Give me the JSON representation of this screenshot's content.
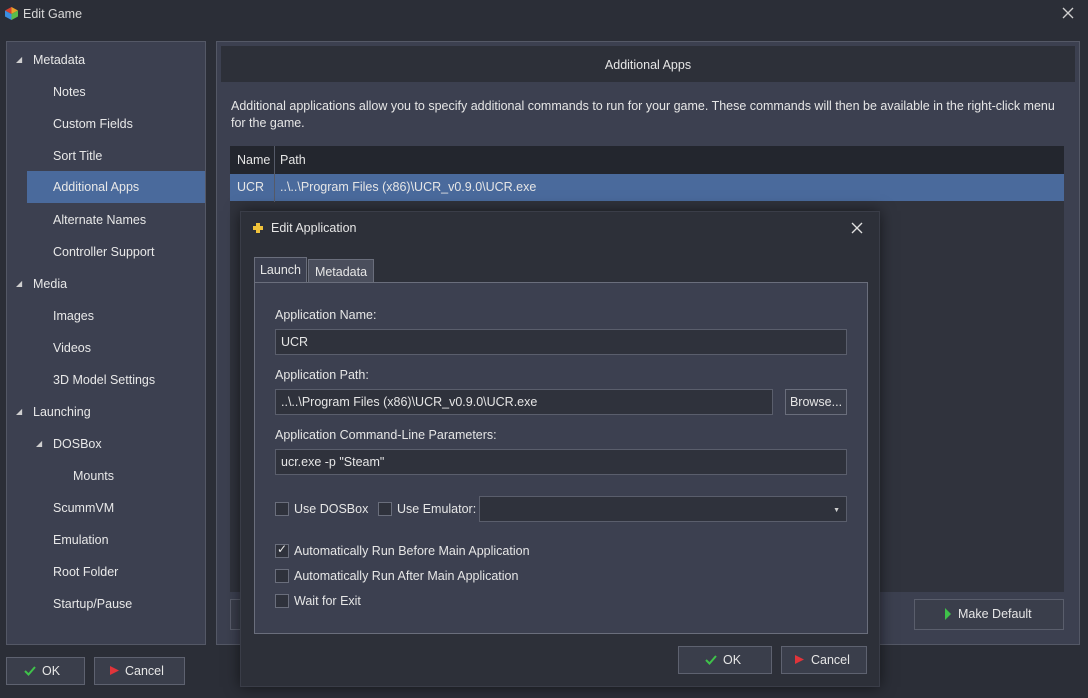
{
  "window": {
    "title": "Edit Game"
  },
  "sidebar": {
    "items": [
      {
        "label": "Metadata",
        "level": 0,
        "expanded": true
      },
      {
        "label": "Notes",
        "level": 1
      },
      {
        "label": "Custom Fields",
        "level": 1
      },
      {
        "label": "Sort Title",
        "level": 1
      },
      {
        "label": "Additional Apps",
        "level": 1,
        "selected": true
      },
      {
        "label": "Alternate Names",
        "level": 1
      },
      {
        "label": "Controller Support",
        "level": 1
      },
      {
        "label": "Media",
        "level": 0,
        "expanded": true
      },
      {
        "label": "Images",
        "level": 1
      },
      {
        "label": "Videos",
        "level": 1
      },
      {
        "label": "3D Model Settings",
        "level": 1
      },
      {
        "label": "Launching",
        "level": 0,
        "expanded": true
      },
      {
        "label": "DOSBox",
        "level": 1,
        "expanded": true
      },
      {
        "label": "Mounts",
        "level": 2
      },
      {
        "label": "ScummVM",
        "level": 1
      },
      {
        "label": "Emulation",
        "level": 1
      },
      {
        "label": "Root Folder",
        "level": 1
      },
      {
        "label": "Startup/Pause",
        "level": 1
      }
    ]
  },
  "main": {
    "header": "Additional Apps",
    "description": "Additional applications allow you to specify additional commands to run for your game.  These commands will then be available in the right-click menu for the game.",
    "table": {
      "columns": [
        "Name",
        "Path"
      ],
      "rows": [
        {
          "name": "UCR",
          "path": "..\\..\\Program Files (x86)\\UCR_v0.9.0\\UCR.exe"
        }
      ]
    },
    "make_default_label": "Make Default"
  },
  "footer": {
    "ok_label": "OK",
    "cancel_label": "Cancel"
  },
  "dialog": {
    "title": "Edit Application",
    "tabs": [
      "Launch",
      "Metadata"
    ],
    "active_tab": "Launch",
    "app_name_label": "Application Name:",
    "app_name_value": "UCR",
    "app_path_label": "Application Path:",
    "app_path_value": "..\\..\\Program Files (x86)\\UCR_v0.9.0\\UCR.exe",
    "browse_label": "Browse...",
    "params_label": "Application Command-Line Parameters:",
    "params_value": "ucr.exe -p \"Steam\"",
    "use_dosbox_label": "Use DOSBox",
    "use_dosbox_checked": false,
    "use_emulator_label": "Use Emulator:",
    "use_emulator_checked": false,
    "emulator_value": "",
    "run_before_label": "Automatically Run Before Main Application",
    "run_before_checked": true,
    "run_after_label": "Automatically Run After Main Application",
    "run_after_checked": false,
    "wait_exit_label": "Wait for Exit",
    "wait_exit_checked": false,
    "ok_label": "OK",
    "cancel_label": "Cancel"
  },
  "colors": {
    "background": "#2b2e37",
    "panel": "#3c4050",
    "selection": "#4a6a9c",
    "ok_check": "#3fc24a",
    "cancel_mark": "#e0343a"
  }
}
